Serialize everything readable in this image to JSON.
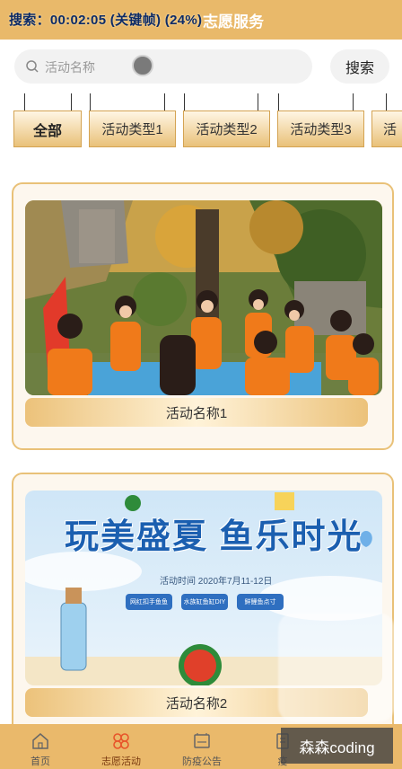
{
  "header": {
    "title": "志愿服务",
    "recording_overlay": "搜索：00:02:05 (关键帧) (24%)"
  },
  "search": {
    "placeholder": "活动名称",
    "button_label": "搜索"
  },
  "tabs": [
    {
      "label": "全部",
      "active": true
    },
    {
      "label": "活动类型1",
      "active": false
    },
    {
      "label": "活动类型2",
      "active": false
    },
    {
      "label": "活动类型3",
      "active": false
    },
    {
      "label": "活",
      "active": false
    }
  ],
  "activities": [
    {
      "name": "活动名称1",
      "image": "volunteers-outdoors-photo"
    },
    {
      "name": "活动名称2",
      "image": "summer-fishing-poster",
      "poster": {
        "headline": "玩美盛夏 鱼乐时光",
        "date": "活动时间 2020年7月11-12日",
        "chips": [
          "网红扣手鱼鱼",
          "水族缸鱼缸DIY",
          "鲜鲤鱼点寸"
        ]
      }
    }
  ],
  "tabbar": [
    {
      "label": "首页",
      "icon": "home-icon",
      "active": false
    },
    {
      "label": "志愿活动",
      "icon": "clover-icon",
      "active": true
    },
    {
      "label": "防疫公告",
      "icon": "notice-board-icon",
      "active": false
    },
    {
      "label": "疫",
      "icon": "document-icon",
      "active": false
    }
  ],
  "watermark": "森森coding",
  "colors": {
    "accent": "#e9b96a",
    "active_icon": "#e8542a"
  }
}
